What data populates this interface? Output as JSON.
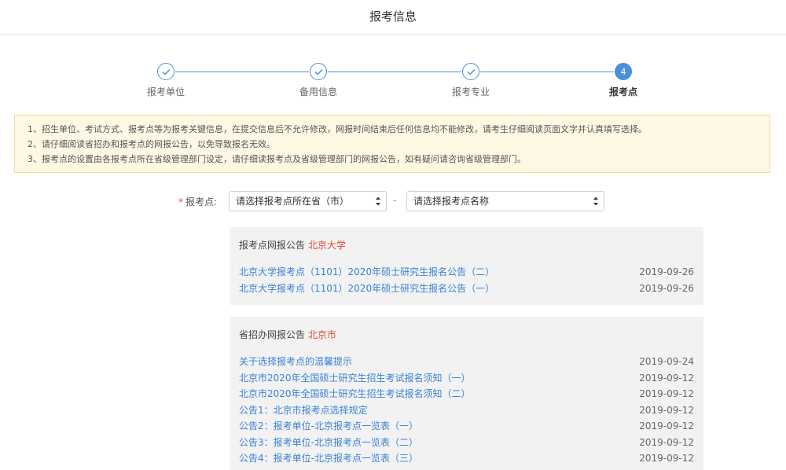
{
  "header": {
    "title": "报考信息"
  },
  "steps": [
    {
      "label": "报考单位",
      "state": "done"
    },
    {
      "label": "备用信息",
      "state": "done"
    },
    {
      "label": "报考专业",
      "state": "done"
    },
    {
      "label": "报考点",
      "state": "active",
      "number": "4"
    }
  ],
  "notice": {
    "lines": [
      "1、招生单位、考试方式、报考点等为报考关键信息，在提交信息后不允许修改，网报时间结束后任何信息均不能修改，请考生仔细阅读页面文字并认真填写选择。",
      "2、请仔细阅读省招办和报考点的网报公告，以免导致报名无效。",
      "3、报考点的设置由各报考点所在省级管理部门设定，请仔细读报考点及省级管理部门的网报公告，如有疑问请咨询省级管理部门。"
    ]
  },
  "form": {
    "required_mark": "*",
    "label": "报考点:",
    "province_select": "请选择报考点所在省（市）",
    "separator": "-",
    "site_select": "请选择报考点名称"
  },
  "site_panel": {
    "title": "报考点网报公告",
    "highlight": "北京大学",
    "items": [
      {
        "title": "北京大学报考点（1101）2020年硕士研究生报名公告（二）",
        "date": "2019-09-26"
      },
      {
        "title": "北京大学报考点（1101）2020年硕士研究生报名公告（一）",
        "date": "2019-09-26"
      }
    ]
  },
  "province_panel": {
    "title": "省招办网报公告",
    "highlight": "北京市",
    "items": [
      {
        "title": "关于选择报考点的温馨提示",
        "date": "2019-09-24"
      },
      {
        "title": "北京市2020年全国硕士研究生招生考试报名须知（一）",
        "date": "2019-09-12"
      },
      {
        "title": "北京市2020年全国硕士研究生招生考试报名须知（二）",
        "date": "2019-09-12"
      },
      {
        "title": "公告1：北京市报考点选择规定",
        "date": "2019-09-12"
      },
      {
        "title": "公告2：报考单位-北京报考点一览表（一）",
        "date": "2019-09-12"
      },
      {
        "title": "公告3：报考单位-北京报考点一览表（二）",
        "date": "2019-09-12"
      },
      {
        "title": "公告4：报考单位-北京报考点一览表（三）",
        "date": "2019-09-12"
      }
    ]
  },
  "colors": {
    "accent": "#4a90d9",
    "link": "#3a82d6",
    "highlight": "#e04b3a",
    "notice_bg": "#fdf7e3"
  }
}
